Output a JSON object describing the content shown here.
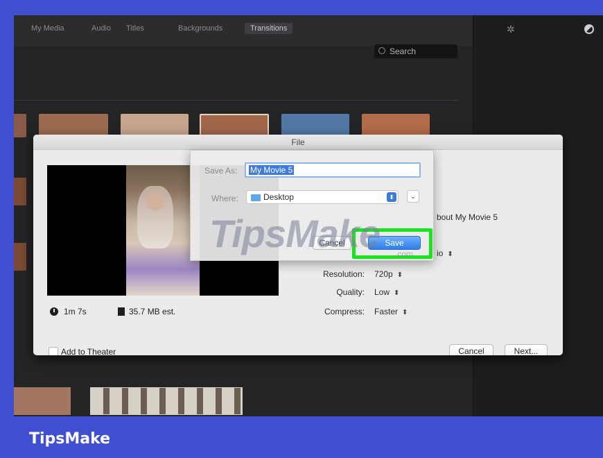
{
  "toolbar": {
    "tabs": [
      {
        "label": "My Media"
      },
      {
        "label": "Audio"
      },
      {
        "label": "Titles"
      },
      {
        "label": "Backgrounds"
      },
      {
        "label": "Transitions"
      }
    ],
    "active_tab": "Transitions",
    "wand_icon": "magic-wand-icon",
    "contrast_icon": "color-correction-icon"
  },
  "search": {
    "label": "Search",
    "icon": "search-icon"
  },
  "dialog": {
    "title": "File",
    "duration": "1m 7s",
    "size": "35.7 MB est.",
    "add_to_theater": "Add to Theater",
    "about_text": "bout My Movie 5",
    "format_value": "io",
    "resolution_label": "Resolution:",
    "resolution_value": "720p",
    "quality_label": "Quality:",
    "quality_value": "Low",
    "compress_label": "Compress:",
    "compress_value": "Faster",
    "cancel_label": "Cancel",
    "next_label": "Next..."
  },
  "save_sheet": {
    "save_as_label": "Save As:",
    "save_as_value": "My Movie 5",
    "where_label": "Where:",
    "where_value": "Desktop",
    "cancel_label": "Cancel",
    "save_label": "Save"
  },
  "watermark": {
    "main": "TipsMake",
    "small": ".com"
  },
  "footer": {
    "brand": "TipsMake"
  },
  "colors": {
    "frame_blue": "#3f4fd0",
    "highlight_green": "#19e51c",
    "save_blue": "#2f7de8"
  }
}
